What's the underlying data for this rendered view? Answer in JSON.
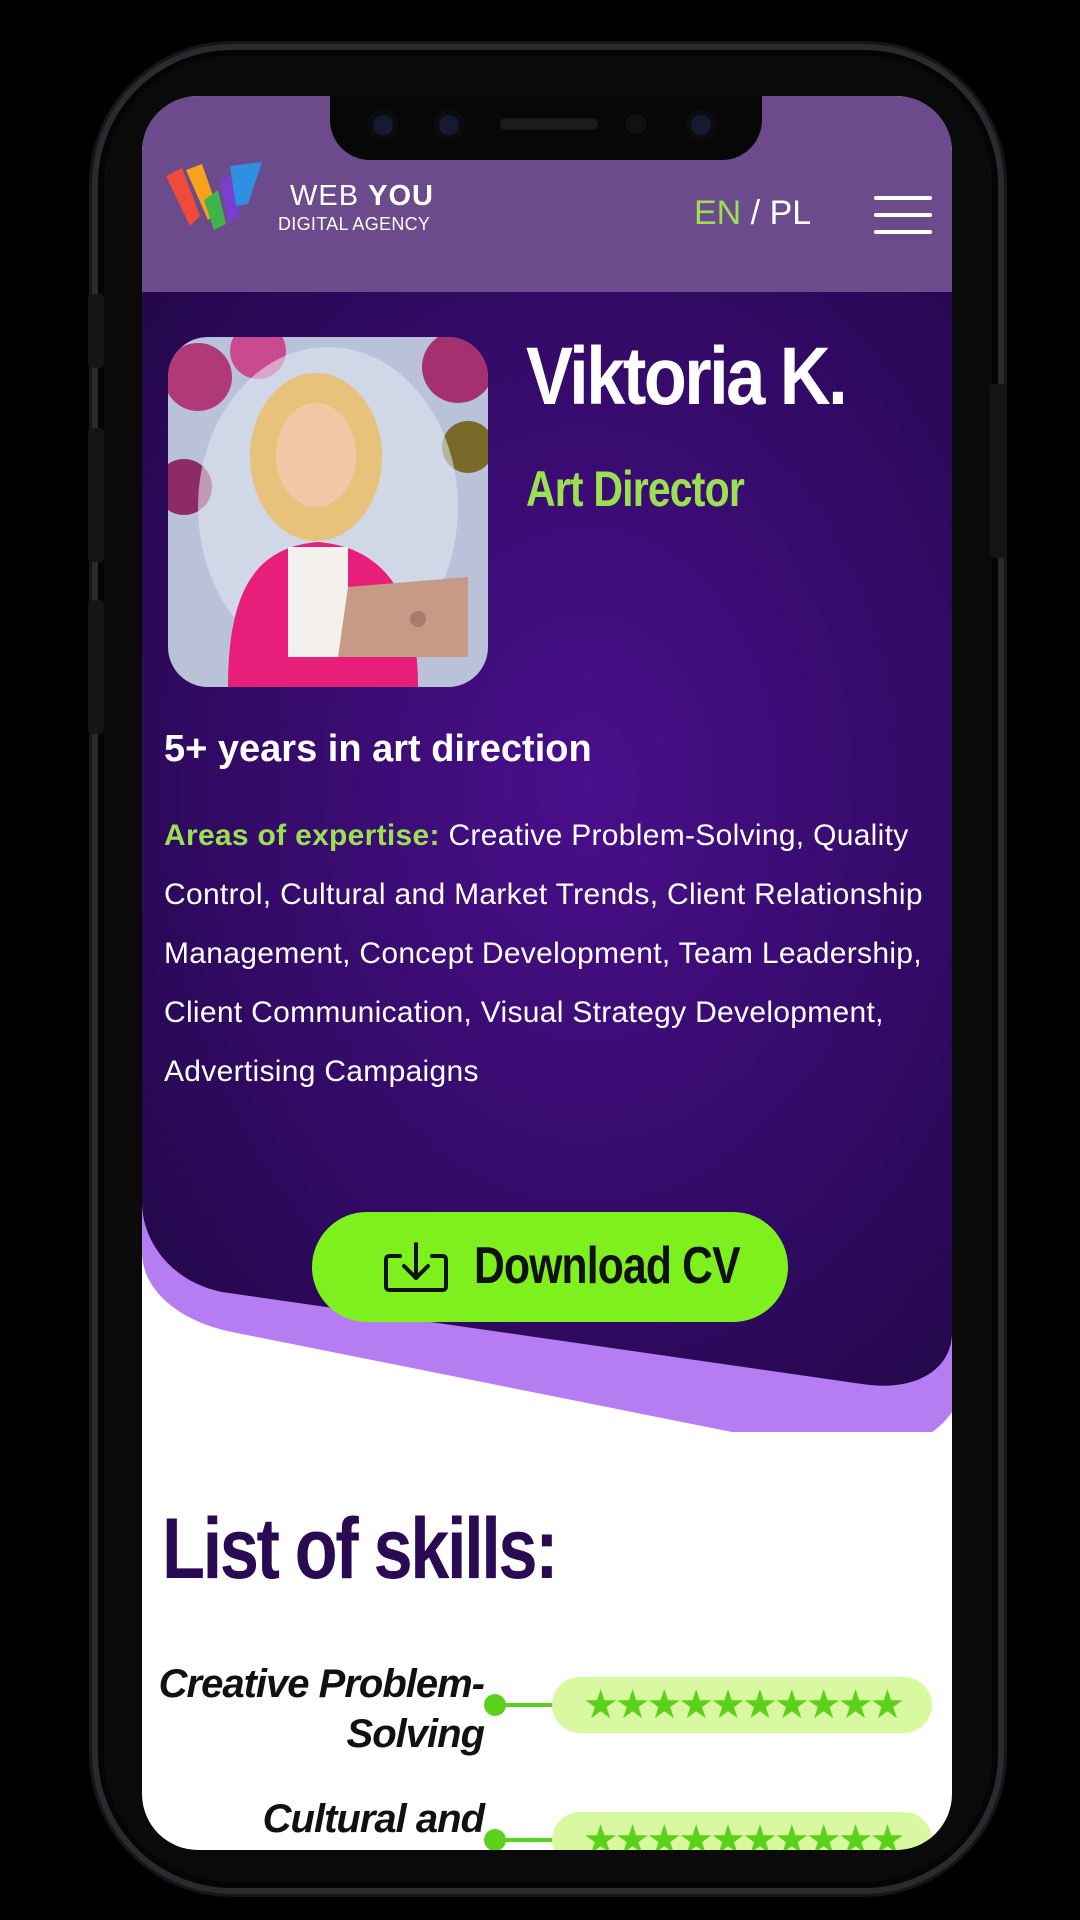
{
  "header": {
    "brand_line1_a": "WEB",
    "brand_line1_b": "YOU",
    "brand_line2": "DIGITAL AGENCY",
    "lang_en": "EN",
    "lang_sep": " / ",
    "lang_pl": "PL"
  },
  "profile": {
    "name": "Viktoria K.",
    "role": "Art Director",
    "experience": "5+ years in art direction",
    "expertise_label": "Areas of expertise:",
    "expertise_text": " Creative Problem-Solving, Quality Control, Cultural and Market Trends, Client Relationship Management, Concept Development, Team Leadership, Client Communication, Visual Strategy Development, Advertising Campaigns"
  },
  "cv_button": {
    "label": "Download CV"
  },
  "skills": {
    "title": "List of skills:",
    "items": [
      {
        "line1": "Creative Problem-",
        "line2": "Solving",
        "stars": "★★★★★★★★★★",
        "rating": 10
      },
      {
        "line1": "Cultural and",
        "line2": "",
        "stars": "★★★★★★★★★★",
        "rating": 10
      }
    ]
  },
  "colors": {
    "header_bg": "#6b4b8b",
    "hero_bg": "#2a0a52",
    "accent_green": "#9be051",
    "button_green": "#7ef01d",
    "wave_purple": "#b67cf2",
    "star_green": "#5cd11c"
  }
}
